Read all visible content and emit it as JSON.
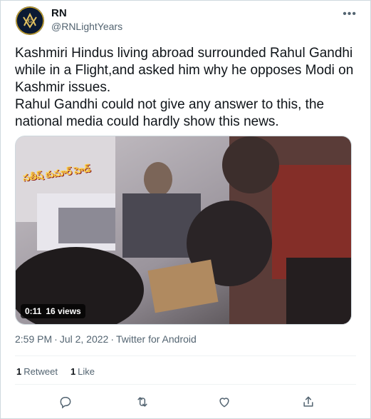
{
  "author": {
    "name": "RN",
    "handle": "@RNLightYears"
  },
  "tweet": {
    "paragraphs": [
      "Kashmiri Hindus living abroad surrounded Rahul Gandhi while in a Flight,and asked him why he opposes Modi on Kashmir issues.",
      "Rahul Gandhi could not give any answer to this, the national media could hardly show this news."
    ]
  },
  "video": {
    "overlay_text": "సతీష్ కుమార్ హెడ్",
    "duration": "0:11",
    "views": "16 views"
  },
  "meta": {
    "time": "2:59 PM",
    "date": "Jul 2, 2022",
    "source": "Twitter for Android"
  },
  "stats": {
    "retweets_count": "1",
    "retweets_label": "Retweet",
    "likes_count": "1",
    "likes_label": "Like"
  },
  "icons": {
    "more": "more-icon",
    "reply": "reply-icon",
    "retweet": "retweet-icon",
    "like": "heart-icon",
    "share": "share-icon"
  },
  "colors": {
    "text": "#0f1419",
    "secondary": "#536471",
    "border": "#cfd9de"
  }
}
